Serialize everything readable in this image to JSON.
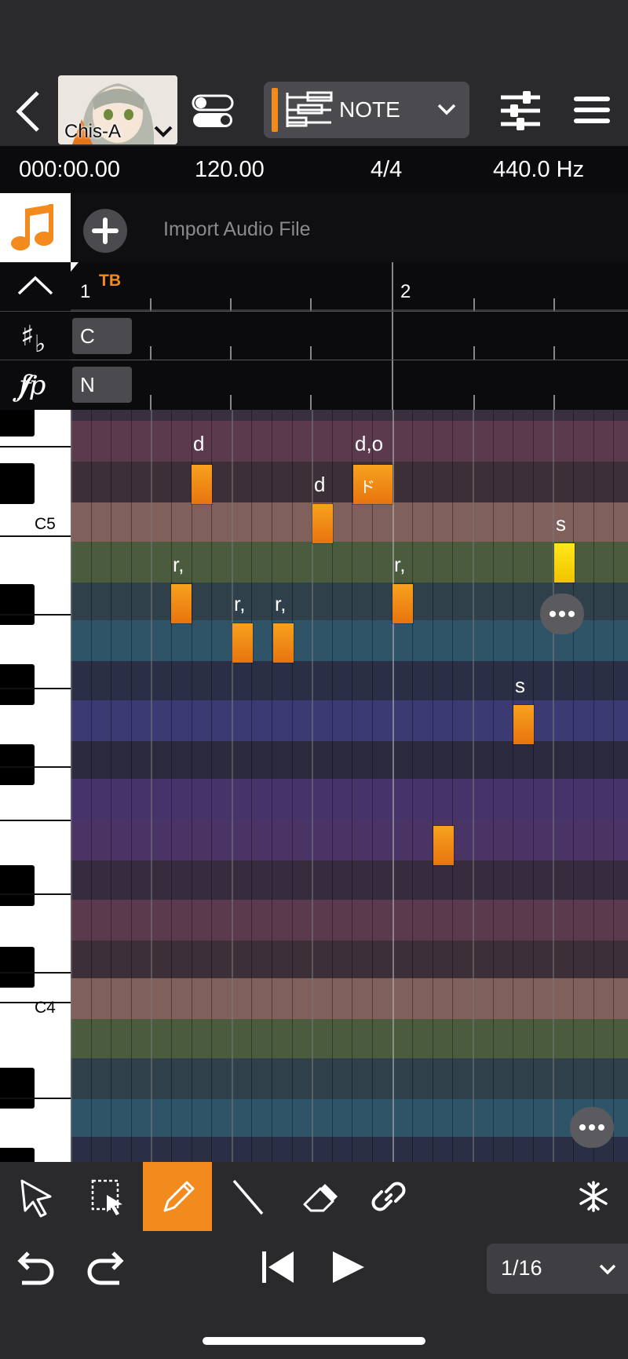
{
  "header": {
    "avatar_name": "Chis-A",
    "mode_label": "NOTE",
    "accent_color": "#f28a1e"
  },
  "info_bar": {
    "time": "000:00.00",
    "tempo": "120.00",
    "time_signature": "4/4",
    "tuning": "440.0 Hz"
  },
  "import": {
    "label": "Import Audio File"
  },
  "ruler": {
    "bar1": "1",
    "bar2": "2",
    "marker": "TB"
  },
  "params": {
    "row1": "C",
    "row2": "N"
  },
  "keyboard": {
    "c5": "C5",
    "c4": "C4"
  },
  "notes": [
    {
      "lyric": "d"
    },
    {
      "lyric": "d"
    },
    {
      "lyric": "d,o",
      "text": "ド"
    },
    {
      "lyric": "s"
    },
    {
      "lyric": "r,"
    },
    {
      "lyric": "r,"
    },
    {
      "lyric": "r,"
    },
    {
      "lyric": "r,"
    },
    {
      "lyric": "s"
    },
    {
      "lyric": ""
    }
  ],
  "toolbar": {
    "tools": [
      "pointer-icon",
      "select-rect-icon",
      "pencil-icon",
      "line-icon",
      "eraser-icon",
      "link-icon",
      "snowflake-icon"
    ],
    "active_tool": "pencil-icon"
  },
  "transport": {
    "quantize": "1/16"
  }
}
